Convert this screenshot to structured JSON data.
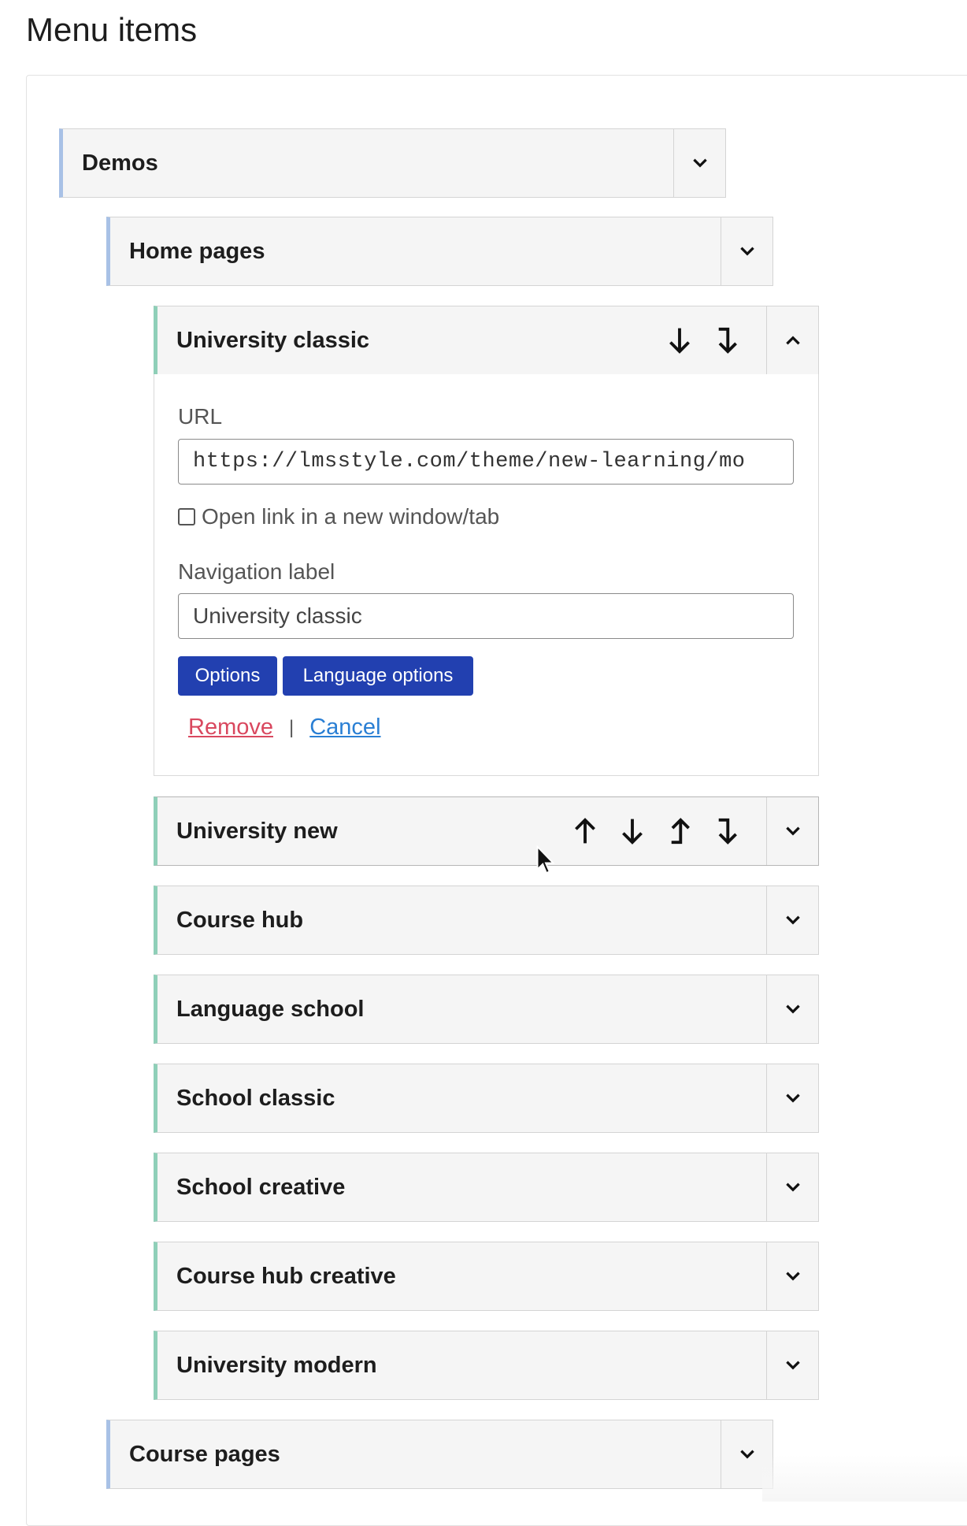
{
  "page": {
    "title": "Menu items"
  },
  "items": {
    "demos": {
      "title": "Demos"
    },
    "home_pages": {
      "title": "Home pages"
    },
    "university_classic": {
      "title": "University classic"
    },
    "university_new": {
      "title": "University new"
    },
    "course_hub": {
      "title": "Course hub"
    },
    "language_school": {
      "title": "Language school"
    },
    "school_classic": {
      "title": "School classic"
    },
    "school_creative": {
      "title": "School creative"
    },
    "course_hub_creative": {
      "title": "Course hub creative"
    },
    "university_modern": {
      "title": "University modern"
    },
    "course_pages": {
      "title": "Course pages"
    }
  },
  "settings": {
    "url_label": "URL",
    "url_value": "https://lmsstyle.com/theme/new-learning/mo",
    "new_window_label": "Open link in a new window/tab",
    "new_window_checked": false,
    "nav_label_label": "Navigation label",
    "nav_label_value": "University classic",
    "options_button": "Options",
    "language_options_button": "Language options",
    "remove_link": "Remove",
    "separator": "|",
    "cancel_link": "Cancel"
  },
  "colors": {
    "button_bg": "#2240b0",
    "remove_link": "#d9485f",
    "cancel_link": "#2a7fd4",
    "level1_accent": "#a8c1e6",
    "level3_accent": "#8fcfb8"
  }
}
